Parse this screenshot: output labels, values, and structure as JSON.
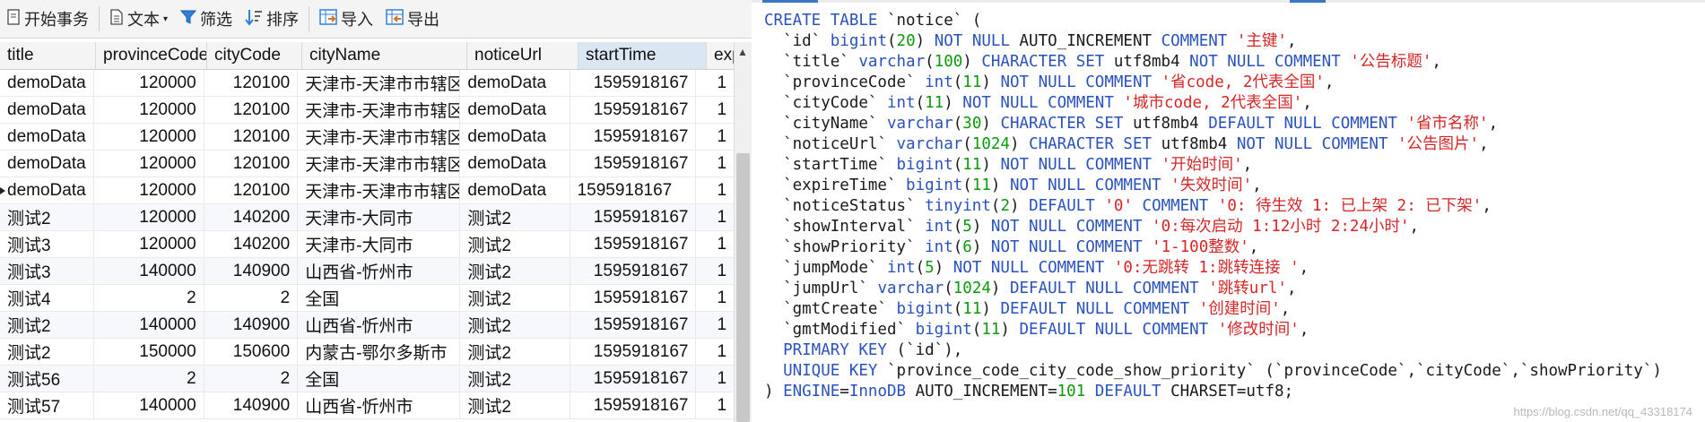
{
  "toolbar": {
    "begin_transaction": "开始事务",
    "text": "文本",
    "filter": "筛选",
    "sort": "排序",
    "import": "导入",
    "export": "导出"
  },
  "grid": {
    "headers": [
      "title",
      "provinceCode",
      "cityCode",
      "cityName",
      "noticeUrl",
      "startTime",
      "exp"
    ],
    "sorted_column": "startTime",
    "current_row": 4,
    "rows": [
      [
        "demoData",
        "120000",
        "120100",
        "天津市-天津市市辖区",
        "demoData",
        "1595918167",
        "1"
      ],
      [
        "demoData",
        "120000",
        "120100",
        "天津市-天津市市辖区",
        "demoData",
        "1595918167",
        "1"
      ],
      [
        "demoData",
        "120000",
        "120100",
        "天津市-天津市市辖区",
        "demoData",
        "1595918167",
        "1"
      ],
      [
        "demoData",
        "120000",
        "120100",
        "天津市-天津市市辖区",
        "demoData",
        "1595918167",
        "1"
      ],
      [
        "demoData",
        "120000",
        "120100",
        "天津市-天津市市辖区",
        "demoData",
        "1595918167",
        "1"
      ],
      [
        "测试2",
        "120000",
        "140200",
        "天津市-大同市",
        "测试2",
        "1595918167",
        "1"
      ],
      [
        "测试3",
        "120000",
        "140200",
        "天津市-大同市",
        "测试2",
        "1595918167",
        "1"
      ],
      [
        "测试3",
        "140000",
        "140900",
        "山西省-忻州市",
        "测试2",
        "1595918167",
        "1"
      ],
      [
        "测试4",
        "2",
        "2",
        "全国",
        "测试2",
        "1595918167",
        "1"
      ],
      [
        "测试2",
        "140000",
        "140900",
        "山西省-忻州市",
        "测试2",
        "1595918167",
        "1"
      ],
      [
        "测试2",
        "150000",
        "150600",
        "内蒙古-鄂尔多斯市",
        "测试2",
        "1595918167",
        "1"
      ],
      [
        "测试56",
        "2",
        "2",
        "全国",
        "测试2",
        "1595918167",
        "1"
      ],
      [
        "测试57",
        "140000",
        "140900",
        "山西省-忻州市",
        "测试2",
        "1595918167",
        "1"
      ]
    ]
  },
  "sql_lines": [
    [
      [
        "kw",
        "CREATE TABLE"
      ],
      [
        "t",
        " `notice` ("
      ]
    ],
    [
      [
        "t",
        "  `id` "
      ],
      [
        "kw",
        "bigint"
      ],
      [
        "t",
        "("
      ],
      [
        "num",
        "20"
      ],
      [
        "t",
        ") "
      ],
      [
        "kw",
        "NOT NULL"
      ],
      [
        "t",
        " AUTO_INCREMENT "
      ],
      [
        "kw",
        "COMMENT"
      ],
      [
        "t",
        " "
      ],
      [
        "str",
        "'主键'"
      ],
      [
        "t",
        ","
      ]
    ],
    [
      [
        "t",
        "  `title` "
      ],
      [
        "kw",
        "varchar"
      ],
      [
        "t",
        "("
      ],
      [
        "num",
        "100"
      ],
      [
        "t",
        ") "
      ],
      [
        "kw",
        "CHARACTER SET"
      ],
      [
        "t",
        " utf8mb4 "
      ],
      [
        "kw",
        "NOT NULL COMMENT"
      ],
      [
        "t",
        " "
      ],
      [
        "str",
        "'公告标题'"
      ],
      [
        "t",
        ","
      ]
    ],
    [
      [
        "t",
        "  `provinceCode` "
      ],
      [
        "kw",
        "int"
      ],
      [
        "t",
        "("
      ],
      [
        "num",
        "11"
      ],
      [
        "t",
        ") "
      ],
      [
        "kw",
        "NOT NULL COMMENT"
      ],
      [
        "t",
        " "
      ],
      [
        "str",
        "'省code, 2代表全国'"
      ],
      [
        "t",
        ","
      ]
    ],
    [
      [
        "t",
        "  `cityCode` "
      ],
      [
        "kw",
        "int"
      ],
      [
        "t",
        "("
      ],
      [
        "num",
        "11"
      ],
      [
        "t",
        ") "
      ],
      [
        "kw",
        "NOT NULL COMMENT"
      ],
      [
        "t",
        " "
      ],
      [
        "str",
        "'城市code, 2代表全国'"
      ],
      [
        "t",
        ","
      ]
    ],
    [
      [
        "t",
        "  `cityName` "
      ],
      [
        "kw",
        "varchar"
      ],
      [
        "t",
        "("
      ],
      [
        "num",
        "30"
      ],
      [
        "t",
        ") "
      ],
      [
        "kw",
        "CHARACTER SET"
      ],
      [
        "t",
        " utf8mb4 "
      ],
      [
        "kw",
        "DEFAULT NULL COMMENT"
      ],
      [
        "t",
        " "
      ],
      [
        "str",
        "'省市名称'"
      ],
      [
        "t",
        ","
      ]
    ],
    [
      [
        "t",
        "  `noticeUrl` "
      ],
      [
        "kw",
        "varchar"
      ],
      [
        "t",
        "("
      ],
      [
        "num",
        "1024"
      ],
      [
        "t",
        ") "
      ],
      [
        "kw",
        "CHARACTER SET"
      ],
      [
        "t",
        " utf8mb4 "
      ],
      [
        "kw",
        "NOT NULL COMMENT"
      ],
      [
        "t",
        " "
      ],
      [
        "str",
        "'公告图片'"
      ],
      [
        "t",
        ","
      ]
    ],
    [
      [
        "t",
        "  `startTime` "
      ],
      [
        "kw",
        "bigint"
      ],
      [
        "t",
        "("
      ],
      [
        "num",
        "11"
      ],
      [
        "t",
        ") "
      ],
      [
        "kw",
        "NOT NULL COMMENT"
      ],
      [
        "t",
        " "
      ],
      [
        "str",
        "'开始时间'"
      ],
      [
        "t",
        ","
      ]
    ],
    [
      [
        "t",
        "  `expireTime` "
      ],
      [
        "kw",
        "bigint"
      ],
      [
        "t",
        "("
      ],
      [
        "num",
        "11"
      ],
      [
        "t",
        ") "
      ],
      [
        "kw",
        "NOT NULL COMMENT"
      ],
      [
        "t",
        " "
      ],
      [
        "str",
        "'失效时间'"
      ],
      [
        "t",
        ","
      ]
    ],
    [
      [
        "t",
        "  `noticeStatus` "
      ],
      [
        "kw",
        "tinyint"
      ],
      [
        "t",
        "("
      ],
      [
        "num",
        "2"
      ],
      [
        "t",
        ") "
      ],
      [
        "kw",
        "DEFAULT"
      ],
      [
        "t",
        " "
      ],
      [
        "str",
        "'0'"
      ],
      [
        "t",
        " "
      ],
      [
        "kw",
        "COMMENT"
      ],
      [
        "t",
        " "
      ],
      [
        "str",
        "'0: 待生效 1: 已上架 2: 已下架'"
      ],
      [
        "t",
        ","
      ]
    ],
    [
      [
        "t",
        "  `showInterval` "
      ],
      [
        "kw",
        "int"
      ],
      [
        "t",
        "("
      ],
      [
        "num",
        "5"
      ],
      [
        "t",
        ") "
      ],
      [
        "kw",
        "NOT NULL COMMENT"
      ],
      [
        "t",
        " "
      ],
      [
        "str",
        "'0:每次启动 1:12小时 2:24小时'"
      ],
      [
        "t",
        ","
      ]
    ],
    [
      [
        "t",
        "  `showPriority` "
      ],
      [
        "kw",
        "int"
      ],
      [
        "t",
        "("
      ],
      [
        "num",
        "6"
      ],
      [
        "t",
        ") "
      ],
      [
        "kw",
        "NOT NULL COMMENT"
      ],
      [
        "t",
        " "
      ],
      [
        "str",
        "'1-100整数'"
      ],
      [
        "t",
        ","
      ]
    ],
    [
      [
        "t",
        "  `jumpMode` "
      ],
      [
        "kw",
        "int"
      ],
      [
        "t",
        "("
      ],
      [
        "num",
        "5"
      ],
      [
        "t",
        ") "
      ],
      [
        "kw",
        "NOT NULL COMMENT"
      ],
      [
        "t",
        " "
      ],
      [
        "str",
        "'0:无跳转 1:跳转连接 '"
      ],
      [
        "t",
        ","
      ]
    ],
    [
      [
        "t",
        "  `jumpUrl` "
      ],
      [
        "kw",
        "varchar"
      ],
      [
        "t",
        "("
      ],
      [
        "num",
        "1024"
      ],
      [
        "t",
        ") "
      ],
      [
        "kw",
        "DEFAULT NULL COMMENT"
      ],
      [
        "t",
        " "
      ],
      [
        "str",
        "'跳转url'"
      ],
      [
        "t",
        ","
      ]
    ],
    [
      [
        "t",
        "  `gmtCreate` "
      ],
      [
        "kw",
        "bigint"
      ],
      [
        "t",
        "("
      ],
      [
        "num",
        "11"
      ],
      [
        "t",
        ") "
      ],
      [
        "kw",
        "DEFAULT NULL COMMENT"
      ],
      [
        "t",
        " "
      ],
      [
        "str",
        "'创建时间'"
      ],
      [
        "t",
        ","
      ]
    ],
    [
      [
        "t",
        "  `gmtModified` "
      ],
      [
        "kw",
        "bigint"
      ],
      [
        "t",
        "("
      ],
      [
        "num",
        "11"
      ],
      [
        "t",
        ") "
      ],
      [
        "kw",
        "DEFAULT NULL COMMENT"
      ],
      [
        "t",
        " "
      ],
      [
        "str",
        "'修改时间'"
      ],
      [
        "t",
        ","
      ]
    ],
    [
      [
        "t",
        "  "
      ],
      [
        "kw",
        "PRIMARY KEY"
      ],
      [
        "t",
        " (`id`),"
      ]
    ],
    [
      [
        "t",
        "  "
      ],
      [
        "kw",
        "UNIQUE KEY"
      ],
      [
        "t",
        " `province_code_city_code_show_priority` (`provinceCode`,`cityCode`,`showPriority`)"
      ]
    ],
    [
      [
        "t",
        ") "
      ],
      [
        "kw",
        "ENGINE"
      ],
      [
        "t",
        "="
      ],
      [
        "kw",
        "InnoDB"
      ],
      [
        "t",
        " AUTO_INCREMENT="
      ],
      [
        "num",
        "101"
      ],
      [
        "t",
        " "
      ],
      [
        "kw",
        "DEFAULT"
      ],
      [
        "t",
        " CHARSET=utf8;"
      ]
    ]
  ],
  "watermark": "https://blog.csdn.net/qq_43318174",
  "colors": {
    "keyword": "#2a52be",
    "number": "#0a9a0a",
    "string": "#d62626",
    "sorted_header": "#dbe6f3"
  },
  "icons": [
    "begin-transaction-icon",
    "text-icon",
    "filter-icon",
    "sort-icon",
    "import-icon",
    "export-icon",
    "scroll-up-icon"
  ]
}
